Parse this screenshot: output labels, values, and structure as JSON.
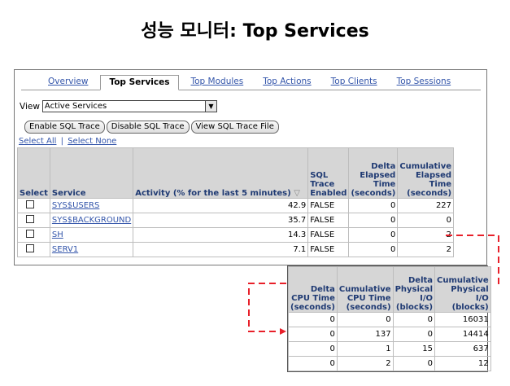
{
  "slide_title": "성능 모니터: Top Services",
  "tabs": [
    {
      "label": "Overview",
      "active": false
    },
    {
      "label": "Top Services",
      "active": true
    },
    {
      "label": "Top Modules",
      "active": false
    },
    {
      "label": "Top Actions",
      "active": false
    },
    {
      "label": "Top Clients",
      "active": false
    },
    {
      "label": "Top Sessions",
      "active": false
    }
  ],
  "view": {
    "label": "View",
    "selected": "Active Services"
  },
  "buttons": {
    "enable": "Enable SQL Trace",
    "disable": "Disable SQL Trace",
    "view_file": "View SQL Trace File"
  },
  "links": {
    "select_all": "Select All",
    "separator": "|",
    "select_none": "Select None"
  },
  "services_table": {
    "headers": {
      "select": "Select",
      "service": "Service",
      "activity": "Activity (% for the last 5 minutes)",
      "sort_indicator": "▽",
      "sql_trace": "SQL Trace Enabled",
      "delta_elapsed": "Delta Elapsed Time (seconds)",
      "cum_elapsed": "Cumulative Elapsed Time (seconds)"
    },
    "rows": [
      {
        "service": "SYS$USERS",
        "activity": "42.9",
        "sql_trace": "FALSE",
        "delta_elapsed": "0",
        "cum_elapsed": "227"
      },
      {
        "service": "SYS$BACKGROUND",
        "activity": "35.7",
        "sql_trace": "FALSE",
        "delta_elapsed": "0",
        "cum_elapsed": "0"
      },
      {
        "service": "SH",
        "activity": "14.3",
        "sql_trace": "FALSE",
        "delta_elapsed": "0",
        "cum_elapsed": "2"
      },
      {
        "service": "SERV1",
        "activity": "7.1",
        "sql_trace": "FALSE",
        "delta_elapsed": "0",
        "cum_elapsed": "2"
      }
    ]
  },
  "cpu_table": {
    "headers": {
      "delta_cpu": "Delta CPU Time (seconds)",
      "cum_cpu": "Cumulative CPU Time (seconds)",
      "delta_io": "Delta Physical I/O (blocks)",
      "cum_io": "Cumulative Physical I/O (blocks)"
    },
    "rows": [
      {
        "delta_cpu": "0",
        "cum_cpu": "0",
        "delta_io": "0",
        "cum_io": "16031"
      },
      {
        "delta_cpu": "0",
        "cum_cpu": "137",
        "delta_io": "0",
        "cum_io": "14414"
      },
      {
        "delta_cpu": "0",
        "cum_cpu": "1",
        "delta_io": "15",
        "cum_io": "637"
      },
      {
        "delta_cpu": "0",
        "cum_cpu": "2",
        "delta_io": "0",
        "cum_io": "12"
      }
    ]
  },
  "colors": {
    "link": "#3355aa",
    "header_text": "#1f3a73",
    "header_bg": "#d6d6d6",
    "callout": "#e8202a"
  }
}
